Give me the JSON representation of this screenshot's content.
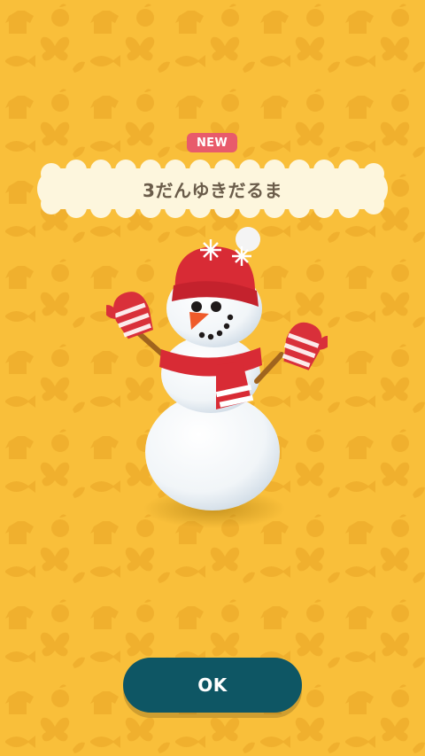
{
  "badge": {
    "label": "NEW",
    "color": "#e85b6b"
  },
  "item": {
    "name": "3だんゆきだるま",
    "image_icon": "snowman-icon"
  },
  "buttons": {
    "ok_label": "OK",
    "ok_color": "#0e5664"
  },
  "theme": {
    "background": "#f9bf3a",
    "pattern_color": "#f3a926",
    "pattern_icons": [
      "shirt-icon",
      "apple-icon",
      "butterfly-icon",
      "fish-icon",
      "leaf-icon"
    ]
  }
}
